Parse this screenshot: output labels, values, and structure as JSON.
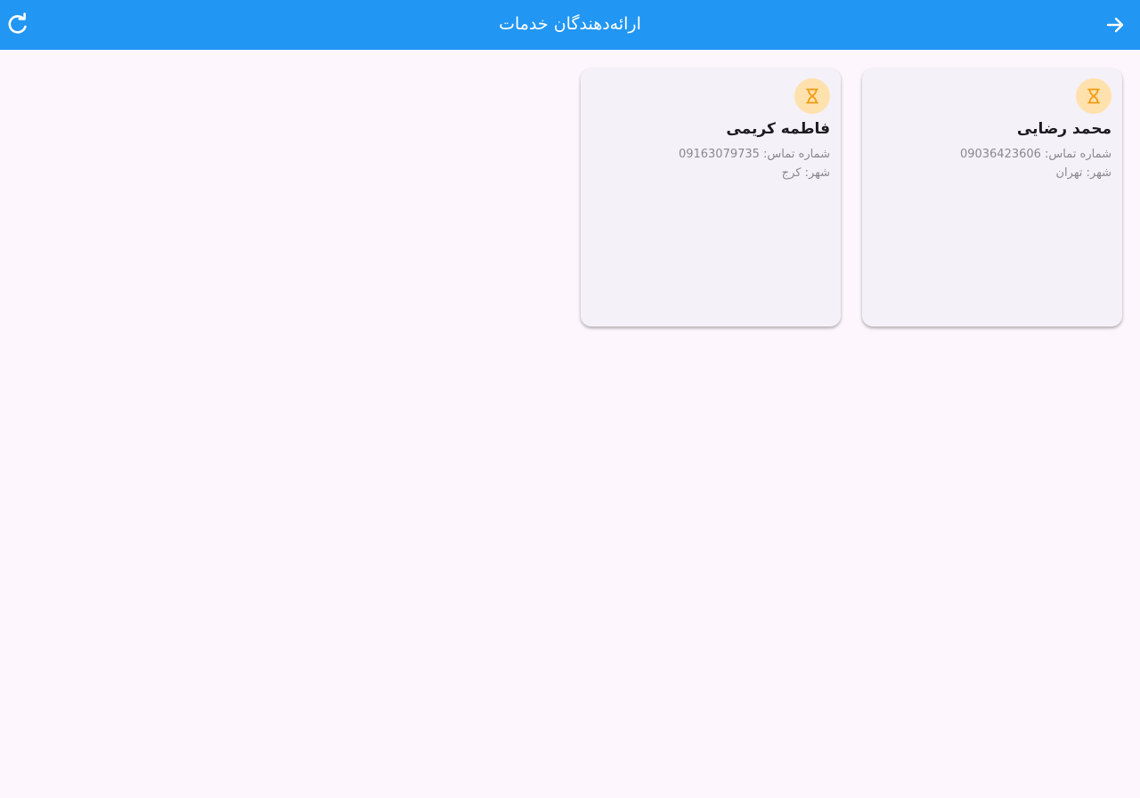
{
  "appbar": {
    "title": "ارائه‌دهندگان خدمات",
    "back_icon": "arrow-forward-icon",
    "refresh_icon": "refresh-icon",
    "color": "#2196f3"
  },
  "providers": [
    {
      "name": "محمد رضایی",
      "phone_line": "شماره تماس: 09036423606",
      "city_line": "شهر: تهران",
      "status_icon": "hourglass-icon",
      "status_color": "#f39c12"
    },
    {
      "name": "فاطمه کریمی",
      "phone_line": "شماره تماس: 09163079735",
      "city_line": "شهر: کرج",
      "status_icon": "hourglass-icon",
      "status_color": "#f39c12"
    }
  ]
}
